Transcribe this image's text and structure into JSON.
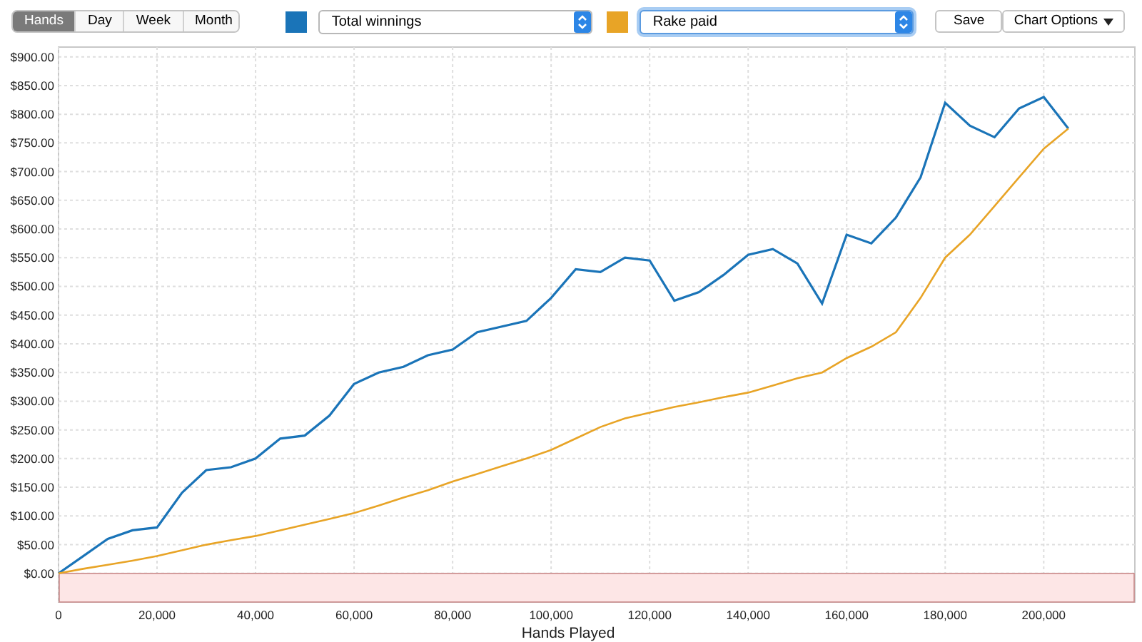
{
  "toolbar": {
    "periods": [
      {
        "label": "Hands",
        "selected": true
      },
      {
        "label": "Day",
        "selected": false
      },
      {
        "label": "Week",
        "selected": false
      },
      {
        "label": "Month",
        "selected": false
      }
    ],
    "selectors": [
      {
        "focused": false
      },
      {
        "focused": true
      }
    ],
    "save_button": "Save",
    "options_button": "Chart Options"
  },
  "chart": {
    "chart_data": {
      "type": "line",
      "grid": true,
      "xlabel": "Hands Played",
      "xlim": [
        0,
        218500
      ],
      "ylim": [
        -50,
        917
      ],
      "x": [
        0,
        5000,
        10000,
        15000,
        20000,
        25000,
        30000,
        35000,
        40000,
        45000,
        50000,
        55000,
        60000,
        65000,
        70000,
        75000,
        80000,
        85000,
        90000,
        95000,
        100000,
        105000,
        110000,
        115000,
        120000,
        125000,
        130000,
        135000,
        140000,
        145000,
        150000,
        155000,
        160000,
        165000,
        170000,
        175000,
        180000,
        185000,
        190000,
        195000,
        200000,
        205000
      ],
      "series": [
        {
          "name": "Total winnings",
          "color": "#1a74b8",
          "values": [
            0,
            30,
            60,
            75,
            80,
            140,
            180,
            185,
            200,
            235,
            240,
            275,
            330,
            350,
            360,
            380,
            390,
            420,
            430,
            440,
            480,
            530,
            525,
            550,
            545,
            475,
            490,
            520,
            555,
            565,
            540,
            470,
            590,
            575,
            620,
            690,
            820,
            780,
            760,
            810,
            830,
            775
          ]
        },
        {
          "name": "Rake paid",
          "color": "#e8a426",
          "values": [
            0,
            8,
            15,
            22,
            30,
            40,
            50,
            58,
            65,
            75,
            85,
            95,
            105,
            118,
            132,
            145,
            160,
            173,
            187,
            200,
            215,
            235,
            255,
            270,
            280,
            290,
            298,
            307,
            315,
            327,
            340,
            350,
            375,
            395,
            420,
            480,
            550,
            590,
            640,
            690,
            740,
            775
          ]
        }
      ],
      "xticks": [
        {
          "value": 0,
          "label": "0"
        },
        {
          "value": 20000,
          "label": "20,000"
        },
        {
          "value": 40000,
          "label": "40,000"
        },
        {
          "value": 60000,
          "label": "60,000"
        },
        {
          "value": 80000,
          "label": "80,000"
        },
        {
          "value": 100000,
          "label": "100,000"
        },
        {
          "value": 120000,
          "label": "120,000"
        },
        {
          "value": 140000,
          "label": "140,000"
        },
        {
          "value": 160000,
          "label": "160,000"
        },
        {
          "value": 180000,
          "label": "180,000"
        },
        {
          "value": 200000,
          "label": "200,000"
        }
      ],
      "yticks": [
        {
          "value": 0,
          "label": "$0.00"
        },
        {
          "value": 50,
          "label": "$50.00"
        },
        {
          "value": 100,
          "label": "$100.00"
        },
        {
          "value": 150,
          "label": "$150.00"
        },
        {
          "value": 200,
          "label": "$200.00"
        },
        {
          "value": 250,
          "label": "$250.00"
        },
        {
          "value": 300,
          "label": "$300.00"
        },
        {
          "value": 350,
          "label": "$350.00"
        },
        {
          "value": 400,
          "label": "$400.00"
        },
        {
          "value": 450,
          "label": "$450.00"
        },
        {
          "value": 500,
          "label": "$500.00"
        },
        {
          "value": 550,
          "label": "$550.00"
        },
        {
          "value": 600,
          "label": "$600.00"
        },
        {
          "value": 650,
          "label": "$650.00"
        },
        {
          "value": 700,
          "label": "$700.00"
        },
        {
          "value": 750,
          "label": "$750.00"
        },
        {
          "value": 800,
          "label": "$800.00"
        },
        {
          "value": 850,
          "label": "$850.00"
        },
        {
          "value": 900,
          "label": "$900.00"
        }
      ]
    }
  }
}
